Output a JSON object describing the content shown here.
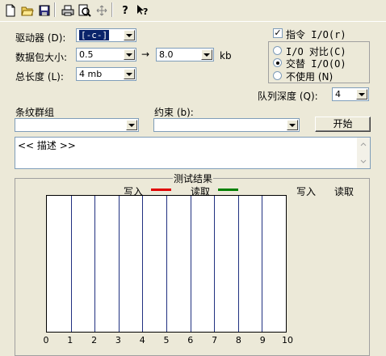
{
  "toolbar": {
    "icons": [
      "new-file-icon",
      "open-folder-icon",
      "save-icon",
      "print-icon",
      "print-preview-icon",
      "move-icon",
      "help-icon",
      "context-help-icon"
    ]
  },
  "form": {
    "drive_label": "驱动器 (D):",
    "drive_value": "[-c-]",
    "packet_size_label": "数据包大小:",
    "packet_size_value": "0.5",
    "arrow": "→",
    "packet_size_value2": "8.0",
    "packet_unit": "kb",
    "total_length_label": "总长度 (L):",
    "total_length_value": "4 mb",
    "stripe_group_label": "条纹群组",
    "stripe_group_value": "",
    "constraint_label": "约束 (b):",
    "constraint_value": "",
    "queue_depth_label": "队列深度 (Q):",
    "queue_depth_value": "4",
    "start_button": "开始",
    "description": "<< 描述 >>"
  },
  "io_options": {
    "instruction_io": "指令 I/O(r)",
    "instruction_io_checked": true,
    "compare_io": "I/O 对比(C)",
    "alternate_io": "交替 I/O(O)",
    "not_used": "不使用 (N)",
    "selected": "alternate_io"
  },
  "results": {
    "title": "测试结果",
    "legend_write": "写入",
    "legend_read": "读取",
    "write_color": "#e00000",
    "read_color": "#008000",
    "col_write": "写入",
    "col_read": "读取"
  },
  "chart_data": {
    "type": "bar",
    "x_ticks": [
      "0",
      "1",
      "2",
      "3",
      "4",
      "5",
      "6",
      "7",
      "8",
      "9",
      "10"
    ],
    "xlim": [
      0,
      10
    ],
    "series": [
      {
        "name": "写入",
        "values": []
      },
      {
        "name": "读取",
        "values": []
      }
    ]
  }
}
